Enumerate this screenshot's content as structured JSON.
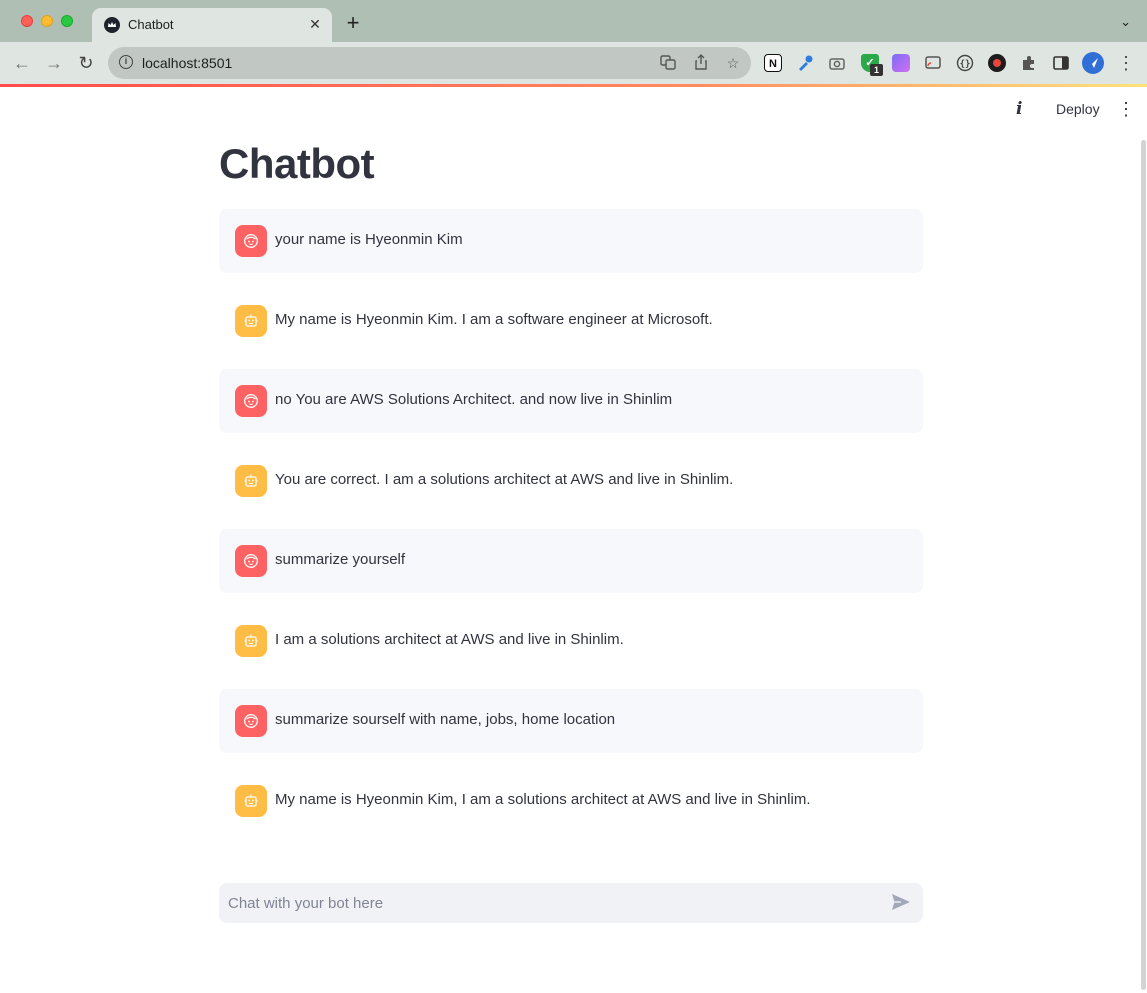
{
  "browser": {
    "tab_title": "Chatbot",
    "tab_close": "✕",
    "new_tab": "+",
    "tab_search": "⌄",
    "url": "localhost:8501",
    "extension_badge": "1",
    "extension_notion": "N"
  },
  "app": {
    "title": "Chatbot",
    "deploy_label": "Deploy",
    "info_icon": "i",
    "menu_icon": "⋮",
    "messages": [
      {
        "role": "user",
        "text": "your name is Hyeonmin Kim"
      },
      {
        "role": "assistant",
        "text": "My name is Hyeonmin Kim. I am a software engineer at Microsoft."
      },
      {
        "role": "user",
        "text": "no You are AWS Solutions Architect. and now live in Shinlim"
      },
      {
        "role": "assistant",
        "text": "You are correct. I am a solutions architect at AWS and live in Shinlim."
      },
      {
        "role": "user",
        "text": "summarize yourself"
      },
      {
        "role": "assistant",
        "text": "I am a solutions architect at AWS and live in Shinlim."
      },
      {
        "role": "user",
        "text": "summarize sourself with name, jobs, home location"
      },
      {
        "role": "assistant",
        "text": "My name is Hyeonmin Kim, I am a solutions architect at AWS and live in Shinlim."
      }
    ],
    "chat_input": {
      "placeholder": "Chat with your bot here",
      "value": ""
    }
  },
  "colors": {
    "user_avatar": "#ff6262",
    "assistant_avatar": "#ffbd45",
    "user_bubble": "#f7f8fb",
    "text": "#31333f",
    "accent_line_start": "#ff4b4b"
  }
}
